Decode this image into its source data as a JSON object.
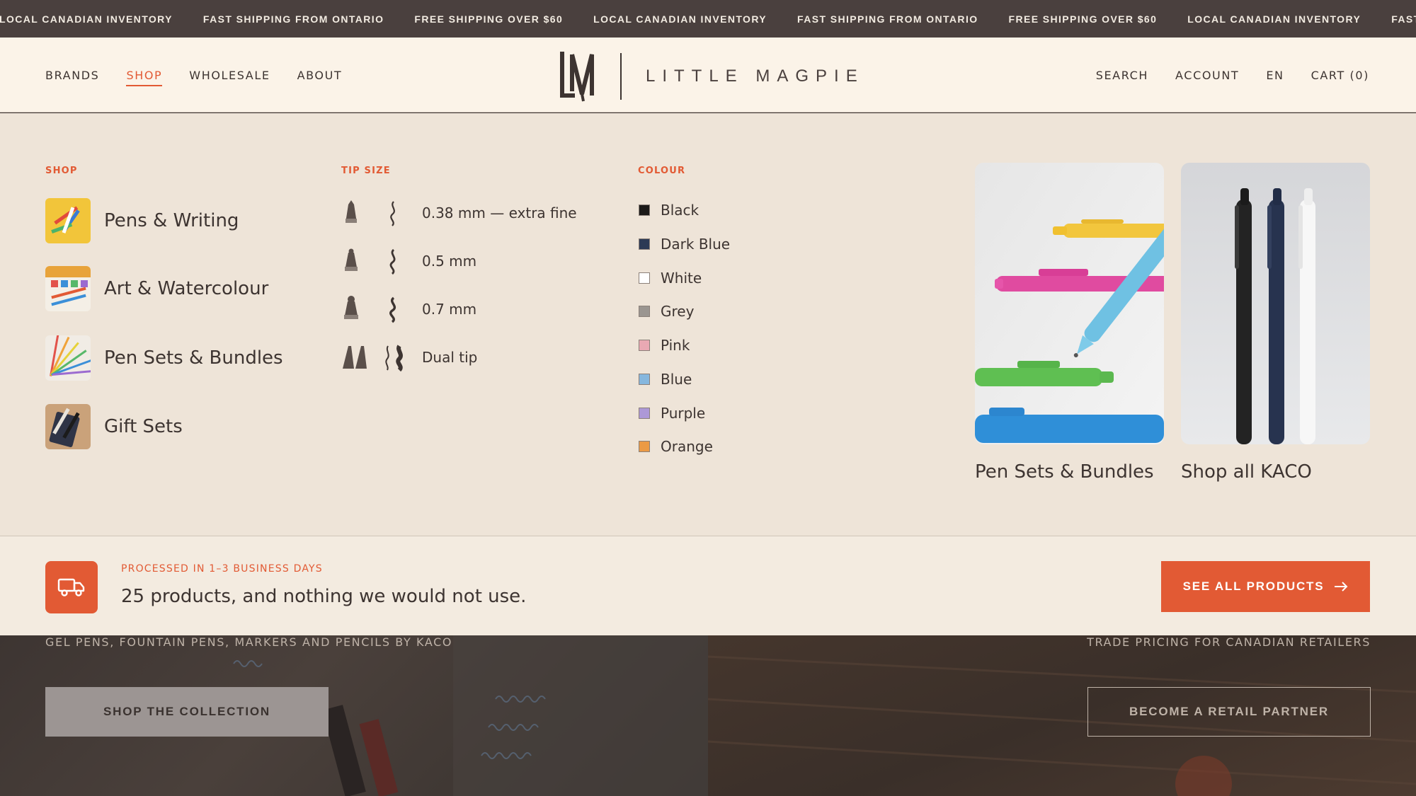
{
  "announcements": [
    "LOCAL CANADIAN INVENTORY",
    "FAST SHIPPING FROM ONTARIO",
    "FREE SHIPPING OVER $60",
    "LOCAL CANADIAN INVENTORY",
    "FAST SHIPPING FROM ONTARIO",
    "FREE SHIPPING OVER $60",
    "LOCAL CANADIAN INVENTORY",
    "FAST SHIPPING FROM ONTARIO"
  ],
  "header": {
    "nav_left": [
      "BRANDS",
      "SHOP",
      "WHOLESALE",
      "ABOUT"
    ],
    "nav_active": "SHOP",
    "logo_text": "LITTLE MAGPIE",
    "nav_right": [
      "SEARCH",
      "ACCOUNT",
      "EN",
      "CART (0)"
    ]
  },
  "mega": {
    "shop_title": "SHOP",
    "shop_items": [
      "Pens & Writing",
      "Art & Watercolour",
      "Pen Sets & Bundles",
      "Gift Sets"
    ],
    "tip_title": "TIP SIZE",
    "tip_items": [
      "0.38 mm — extra fine",
      "0.5 mm",
      "0.7 mm",
      "Dual tip"
    ],
    "colour_title": "COLOUR",
    "colours": [
      {
        "label": "Black",
        "color": "#1c1a19"
      },
      {
        "label": "Dark Blue",
        "color": "#2c3a55"
      },
      {
        "label": "White",
        "color": "#ffffff"
      },
      {
        "label": "Grey",
        "color": "#9a9590"
      },
      {
        "label": "Pink",
        "color": "#e9a9b3"
      },
      {
        "label": "Blue",
        "color": "#86b7de"
      },
      {
        "label": "Purple",
        "color": "#ad98d6"
      },
      {
        "label": "Orange",
        "color": "#eb9a45"
      }
    ],
    "promos": [
      "Pen Sets & Bundles",
      "Shop all KACO"
    ]
  },
  "strip": {
    "kicker": "PROCESSED IN 1–3 BUSINESS DAYS",
    "text": "25 products, and nothing we would not use.",
    "cta": "SEE ALL PRODUCTS"
  },
  "hero": {
    "left_caption": "GEL PENS, FOUNTAIN PENS, MARKERS AND PENCILS BY KACO",
    "left_button": "SHOP THE COLLECTION",
    "right_caption": "TRADE PRICING FOR CANADIAN RETAILERS",
    "right_button": "BECOME A RETAIL PARTNER"
  },
  "colors": {
    "accent": "#e25a34",
    "header_bg": "#fbf3e8",
    "menu_bg": "#eee4d8"
  }
}
